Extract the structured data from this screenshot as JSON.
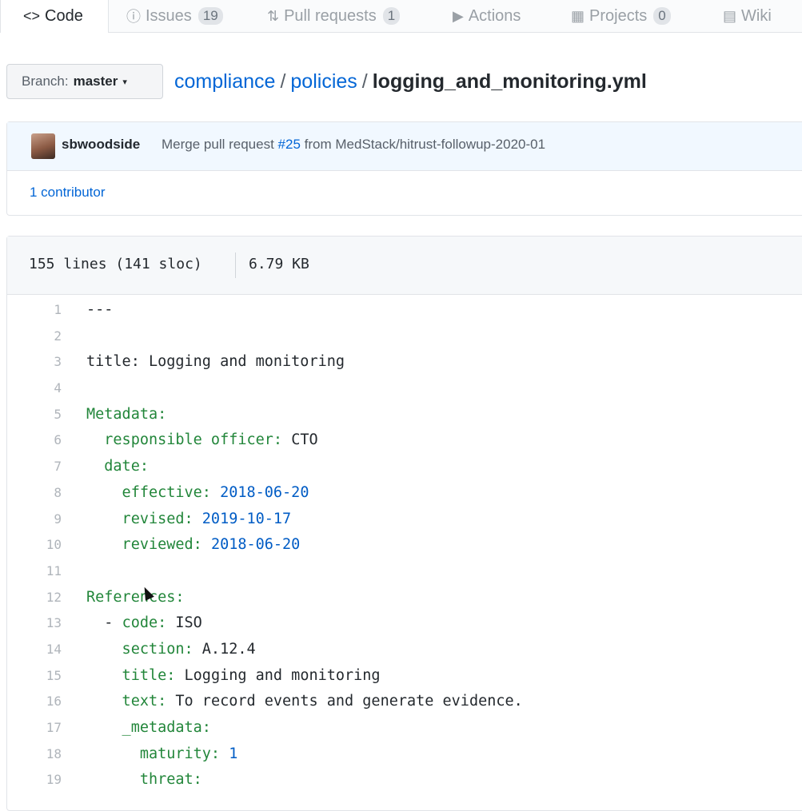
{
  "tabs": [
    {
      "label": "Code",
      "icon": "code-icon",
      "glyph": "<>"
    },
    {
      "label": "Issues",
      "icon": "issue-icon",
      "glyph": "ⓘ",
      "count": "19"
    },
    {
      "label": "Pull requests",
      "icon": "pull-request-icon",
      "glyph": "⇅",
      "count": "1"
    },
    {
      "label": "Actions",
      "icon": "actions-icon",
      "glyph": "▶"
    },
    {
      "label": "Projects",
      "icon": "project-icon",
      "glyph": "▦",
      "count": "0"
    },
    {
      "label": "Wiki",
      "icon": "wiki-icon",
      "glyph": "▤"
    }
  ],
  "branch": {
    "prefix": "Branch:",
    "name": "master",
    "caret": "▾"
  },
  "breadcrumb": {
    "repo": "compliance",
    "sep": "/",
    "folder": "policies",
    "file": "logging_and_monitoring.yml"
  },
  "commit": {
    "author": "sbwoodside",
    "message_prefix": "Merge pull request",
    "pr": "#25",
    "message_suffix": "from MedStack/hitrust-followup-2020-01",
    "contributors": "1 contributor"
  },
  "file": {
    "lines": "155 lines (141 sloc)",
    "size": "6.79 KB"
  },
  "code_lines": [
    {
      "n": "1",
      "parts": [
        {
          "t": "---",
          "c": "plain"
        }
      ]
    },
    {
      "n": "2",
      "parts": []
    },
    {
      "n": "3",
      "parts": [
        {
          "t": "title: Logging and monitoring",
          "c": "plain"
        }
      ]
    },
    {
      "n": "4",
      "parts": []
    },
    {
      "n": "5",
      "parts": [
        {
          "t": "Metadata:",
          "c": "k"
        }
      ]
    },
    {
      "n": "6",
      "parts": [
        {
          "t": "  responsible officer: ",
          "c": "k"
        },
        {
          "t": "CTO",
          "c": "plain"
        }
      ]
    },
    {
      "n": "7",
      "parts": [
        {
          "t": "  date:",
          "c": "k"
        }
      ]
    },
    {
      "n": "8",
      "parts": [
        {
          "t": "    effective: ",
          "c": "k"
        },
        {
          "t": "2018-06-20",
          "c": "num-v"
        }
      ]
    },
    {
      "n": "9",
      "parts": [
        {
          "t": "    revised: ",
          "c": "k"
        },
        {
          "t": "2019-10-17",
          "c": "num-v"
        }
      ]
    },
    {
      "n": "10",
      "parts": [
        {
          "t": "    reviewed: ",
          "c": "k"
        },
        {
          "t": "2018-06-20",
          "c": "num-v"
        }
      ]
    },
    {
      "n": "11",
      "parts": []
    },
    {
      "n": "12",
      "parts": [
        {
          "t": "References:",
          "c": "k"
        }
      ]
    },
    {
      "n": "13",
      "parts": [
        {
          "t": "  - ",
          "c": "plain"
        },
        {
          "t": "code: ",
          "c": "k"
        },
        {
          "t": "ISO",
          "c": "plain"
        }
      ]
    },
    {
      "n": "14",
      "parts": [
        {
          "t": "    section: ",
          "c": "k"
        },
        {
          "t": "A.12.4",
          "c": "plain"
        }
      ]
    },
    {
      "n": "15",
      "parts": [
        {
          "t": "    title: ",
          "c": "k"
        },
        {
          "t": "Logging and monitoring",
          "c": "plain"
        }
      ]
    },
    {
      "n": "16",
      "parts": [
        {
          "t": "    text: ",
          "c": "k"
        },
        {
          "t": "To record events and generate evidence.",
          "c": "plain"
        }
      ]
    },
    {
      "n": "17",
      "parts": [
        {
          "t": "    _metadata:",
          "c": "k"
        }
      ]
    },
    {
      "n": "18",
      "parts": [
        {
          "t": "      maturity: ",
          "c": "k"
        },
        {
          "t": "1",
          "c": "num-v"
        }
      ]
    },
    {
      "n": "19",
      "parts": [
        {
          "t": "      threat:",
          "c": "k"
        }
      ]
    }
  ]
}
